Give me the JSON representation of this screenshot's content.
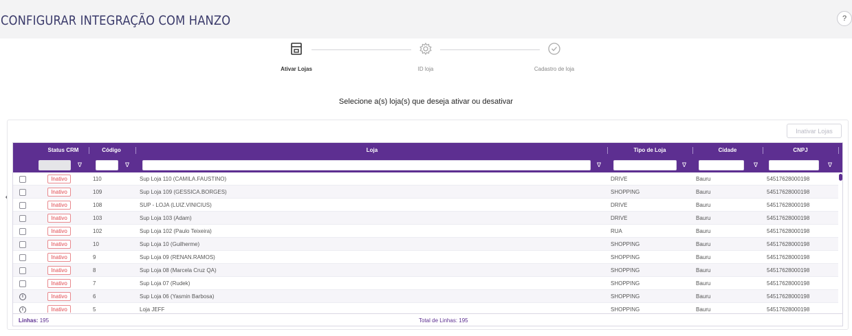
{
  "page": {
    "title": "CONFIGURAR INTEGRAÇÃO COM HANZO",
    "help_label": "?"
  },
  "stepper": {
    "steps": [
      {
        "label": "Ativar Lojas",
        "icon": "store-icon",
        "state": "active"
      },
      {
        "label": "ID loja",
        "icon": "gear-icon",
        "state": "inactive"
      },
      {
        "label": "Cadastro de loja",
        "icon": "check-circle-icon",
        "state": "inactive"
      }
    ]
  },
  "subtitle": "Selecione a(s) loja(s) que deseja ativar ou desativar",
  "toolbar": {
    "inativar_label": "Inativar Lojas"
  },
  "grid": {
    "columns": [
      "Status CRM",
      "Código",
      "Loja",
      "Tipo de Loja",
      "Cidade",
      "CNPJ"
    ],
    "filter_icon": "filter-icon",
    "rows": [
      {
        "marker": "checkbox",
        "status": "Inativo",
        "codigo": "110",
        "loja": "Sup Loja 110 (CAMILA.FAUSTINO)",
        "tipo": "DRIVE",
        "cidade": "Bauru",
        "cnpj": "54517628000198"
      },
      {
        "marker": "checkbox",
        "status": "Inativo",
        "codigo": "109",
        "loja": "Sup Loja 109 (GESSICA.BORGES)",
        "tipo": "SHOPPING",
        "cidade": "Bauru",
        "cnpj": "54517628000198"
      },
      {
        "marker": "checkbox",
        "status": "Inativo",
        "codigo": "108",
        "loja": "SUP - LOJA (LUIZ.VINICIUS)",
        "tipo": "DRIVE",
        "cidade": "Bauru",
        "cnpj": "54517628000198"
      },
      {
        "marker": "checkbox",
        "status": "Inativo",
        "codigo": "103",
        "loja": "Sup Loja 103 (Adam)",
        "tipo": "DRIVE",
        "cidade": "Bauru",
        "cnpj": "54517628000198"
      },
      {
        "marker": "checkbox",
        "status": "Inativo",
        "codigo": "102",
        "loja": "Sup Loja 102 (Paulo Teixeira)",
        "tipo": "RUA",
        "cidade": "Bauru",
        "cnpj": "54517628000198"
      },
      {
        "marker": "checkbox",
        "status": "Inativo",
        "codigo": "10",
        "loja": "Sup Loja 10 (Guilherme)",
        "tipo": "SHOPPING",
        "cidade": "Bauru",
        "cnpj": "54517628000198"
      },
      {
        "marker": "checkbox",
        "status": "Inativo",
        "codigo": "9",
        "loja": "Sup Loja 09 (RENAN.RAMOS)",
        "tipo": "SHOPPING",
        "cidade": "Bauru",
        "cnpj": "54517628000198"
      },
      {
        "marker": "checkbox",
        "status": "Inativo",
        "codigo": "8",
        "loja": "Sup Loja 08 (Marcela Cruz QA)",
        "tipo": "SHOPPING",
        "cidade": "Bauru",
        "cnpj": "54517628000198"
      },
      {
        "marker": "checkbox",
        "status": "Inativo",
        "codigo": "7",
        "loja": "Sup Loja 07 (Rudek)",
        "tipo": "SHOPPING",
        "cidade": "Bauru",
        "cnpj": "54517628000198"
      },
      {
        "marker": "info",
        "status": "Inativo",
        "codigo": "6",
        "loja": "Sup Loja 06 (Yasmin Barbosa)",
        "tipo": "SHOPPING",
        "cidade": "Bauru",
        "cnpj": "54517628000198"
      },
      {
        "marker": "info",
        "status": "Inativo",
        "codigo": "5",
        "loja": "Loja JEFF",
        "tipo": "SHOPPING",
        "cidade": "Bauru",
        "cnpj": "54517628000198"
      }
    ]
  },
  "footer": {
    "linhas_label": "Linhas:",
    "linhas_value": "195",
    "total_label": "Total de Linhas:",
    "total_value": "195"
  }
}
